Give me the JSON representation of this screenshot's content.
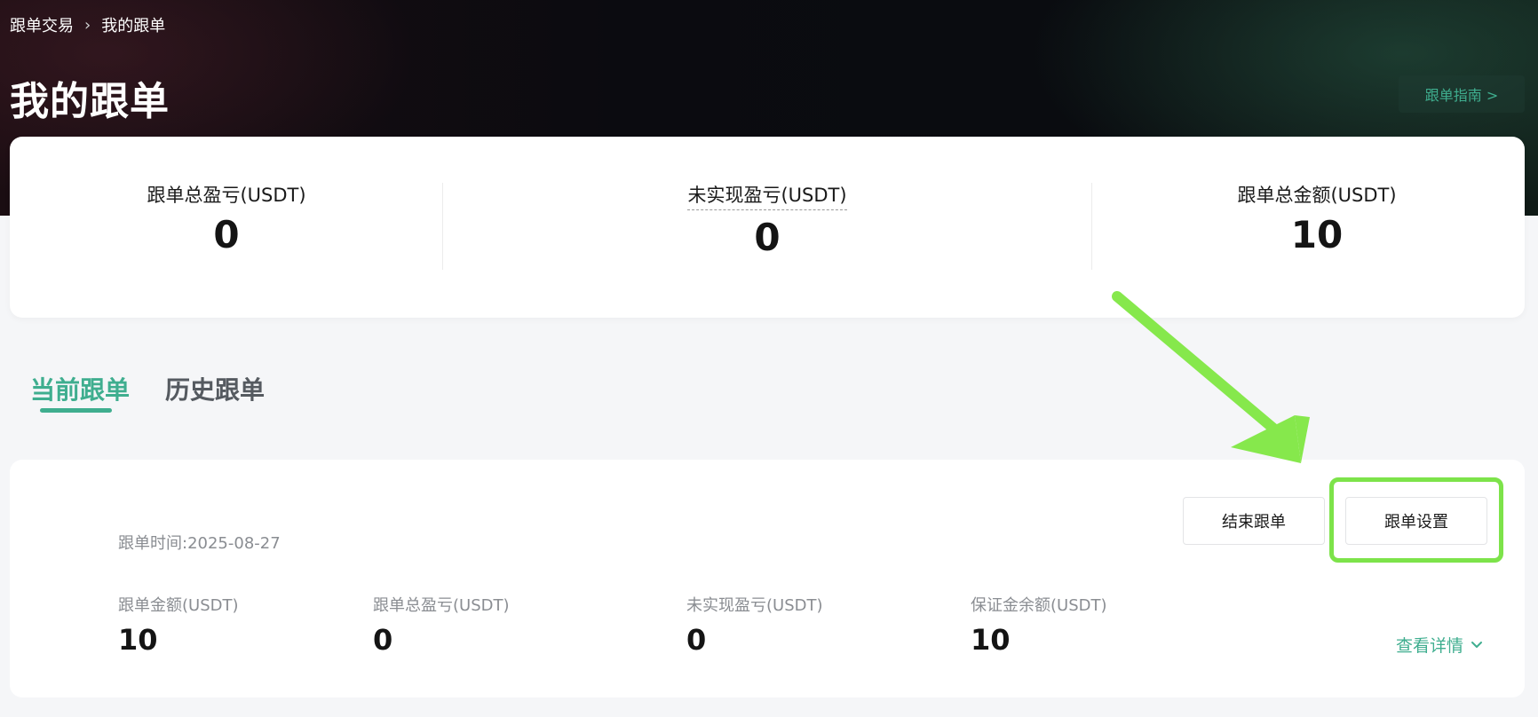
{
  "breadcrumb": {
    "parent": "跟单交易",
    "separator": "›",
    "current": "我的跟单"
  },
  "page_title": "我的跟单",
  "guide_button": "跟单指南 >",
  "summary": {
    "total_pnl_label": "跟单总盈亏(USDT)",
    "total_pnl_value": "0",
    "unrealized_pnl_label": "未实现盈亏(USDT)",
    "unrealized_pnl_value": "0",
    "total_amount_label": "跟单总金额(USDT)",
    "total_amount_value": "10"
  },
  "tabs": [
    {
      "label": "当前跟单",
      "active": true
    },
    {
      "label": "历史跟单",
      "active": false
    }
  ],
  "order": {
    "time_text": "跟单时间:2025-08-27",
    "end_button": "结束跟单",
    "settings_button": "跟单设置",
    "metrics": [
      {
        "label": "跟单金额(USDT)",
        "value": "10"
      },
      {
        "label": "跟单总盈亏(USDT)",
        "value": "0"
      },
      {
        "label": "未实现盈亏(USDT)",
        "value": "0"
      },
      {
        "label": "保证金余额(USDT)",
        "value": "10"
      }
    ],
    "details_link": "查看详情"
  },
  "colors": {
    "accent": "#3fae8f",
    "highlight": "#7de34a",
    "arrow": "#86e84c"
  },
  "icons": {
    "breadcrumb_separator": "chevron-right-icon",
    "details_toggle": "chevron-down-icon",
    "annotation": "arrow-annotation-icon"
  }
}
